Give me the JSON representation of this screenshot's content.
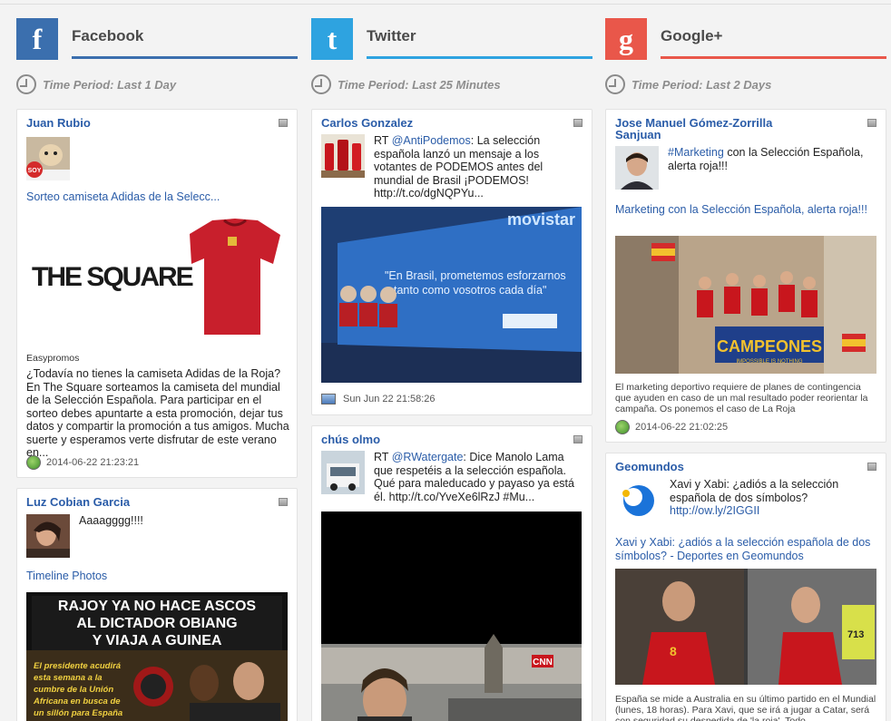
{
  "columns": {
    "facebook": {
      "logo_letter": "f",
      "name": "Facebook",
      "period": "Time Period: Last 1 Day",
      "color": "#3b6fae",
      "posts": [
        {
          "author": "Juan Rubio",
          "link": "Sorteo camiseta Adidas de la Selecc...",
          "source": "Easypromos",
          "body": "¿Todavía no tienes la camiseta Adidas de la Roja? En The Square sorteamos la camiseta del mundial de la Selección Española. Para participar en el sorteo debes apuntarte a esta promoción, dejar tus datos y compartir la promoción a tus amigos. Mucha suerte y esperamos verte disfrutar de este verano en...",
          "timestamp": "2014-06-22 21:23:21",
          "image_text": "THE SQUARE",
          "avatar_text": "SOY"
        },
        {
          "author": "Luz Cobian Garcia",
          "message": "Aaaagggg!!!!",
          "link": "Timeline Photos",
          "image_lines": [
            "RAJOY YA NO HACE ASCOS",
            "AL DICTADOR OBIANG",
            "Y VIAJA A GUINEA"
          ],
          "image_sub": [
            "El presidente acudirá",
            "esta semana a la",
            "cumbre de la Unión",
            "Africana en busca de",
            "un sillón para España"
          ]
        }
      ]
    },
    "twitter": {
      "logo_letter": "t",
      "name": "Twitter",
      "period": "Time Period: Last 25 Minutes",
      "color": "#2ea3e0",
      "posts": [
        {
          "author": "Carlos Gonzalez",
          "prefix": "RT",
          "mention": "@AntiPodemos",
          "body": ": La selección española lanzó un mensaje a los votantes de PODEMOS antes del mundial de Brasil ¡PODEMOS! http://t.co/dgNQPYu...",
          "image_brand": "movistar",
          "image_slogan_1": "\"En Brasil, prometemos esforzarnos",
          "image_slogan_2": "tanto como vosotros cada día\"",
          "timestamp": "Sun Jun 22 21:58:26"
        },
        {
          "author": "chús olmo",
          "prefix": "RT",
          "mention": "@RWatergate",
          "body": ": Dice Manolo Lama que respetéis a la selección española. Qué para maleducado y payaso ya está él. http://t.co/YveXe6lRzJ #Mu...",
          "image_badge": "CNN"
        }
      ]
    },
    "googleplus": {
      "logo_letter": "g",
      "name": "Google+",
      "period": "Time Period: Last 2 Days",
      "color": "#e9574a",
      "posts": [
        {
          "author": "Jose Manuel Gómez-Zorrilla Sanjuan",
          "hashtag": "#Marketing",
          "message": " con la Selección Española, alerta roja!!!",
          "link": "Marketing con la Selección Española, alerta roja!!!",
          "image_banner": "CAMPEONES",
          "image_banner_sub": "IMPOSSIBLE IS NOTHING",
          "body": "El marketing deportivo requiere de planes de contingencia que ayuden en caso de un mal resultado poder reorientar la campaña. Os ponemos el caso de La Roja",
          "timestamp": "2014-06-22 21:02:25"
        },
        {
          "author": "Geomundos",
          "message": "Xavi y Xabi: ¿adiós a la selección española de dos símbolos?",
          "message_link": "http://ow.ly/2IGGII",
          "link": "Xavi y Xabi: ¿adiós a la selección española de dos símbolos? - Deportes en Geomundos",
          "image_numbers": [
            "8",
            "713"
          ],
          "body": "España se mide a Australia en su último partido en el Mundial (lunes, 18 horas). Para Xavi, que se irá a jugar a Catar, será con seguridad su despedida de 'la roja'. Todo"
        }
      ]
    }
  }
}
